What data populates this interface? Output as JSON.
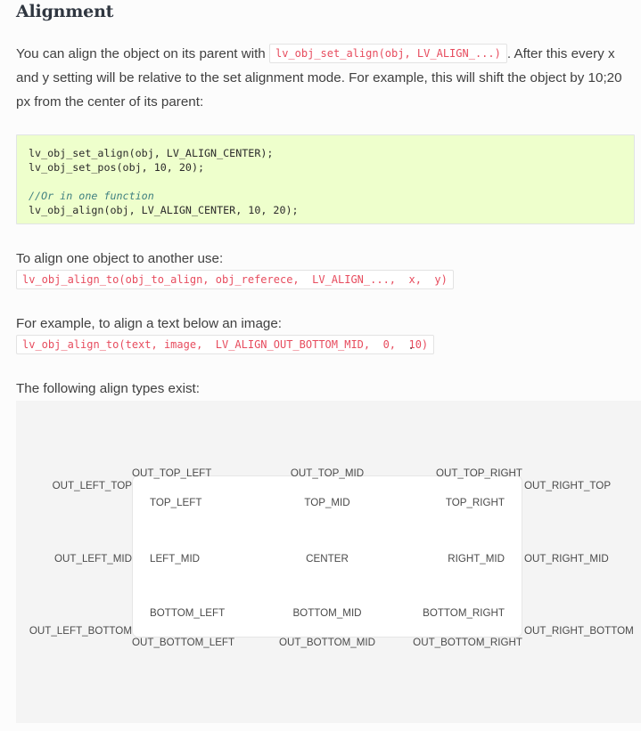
{
  "heading": "Alignment",
  "paragraphs": {
    "intro_part1": "You can align the object on its parent with ",
    "intro_code": "lv_obj_set_align(obj, LV_ALIGN_...)",
    "intro_part2": ". After this every x and y setting will be relative to the set alignment mode. For example, this will shift the object by 10;20 px from the center of its parent:",
    "align_to_label": "To align one object to another use:",
    "align_to_code": "lv_obj_align_to(obj_to_align, obj_referece,  LV_ALIGN_...,  x,  y)",
    "example_label": "For example, to align a text below an image:",
    "example_code": "lv_obj_align_to(text, image,  LV_ALIGN_OUT_BOTTOM_MID,  0,  10)",
    "example_period": ".",
    "types_label": "The following align types exist:"
  },
  "code_block": {
    "line1": "lv_obj_set_align(obj, LV_ALIGN_CENTER);",
    "line2": "lv_obj_set_pos(obj, 10, 20);",
    "line3": "",
    "comment": "//Or in one function",
    "line5": "lv_obj_align(obj, LV_ALIGN_CENTER, 10, 20);"
  },
  "diagram": {
    "inner": {
      "top_left": "TOP_LEFT",
      "top_mid": "TOP_MID",
      "top_right": "TOP_RIGHT",
      "left_mid": "LEFT_MID",
      "center": "CENTER",
      "right_mid": "RIGHT_MID",
      "bottom_left": "BOTTOM_LEFT",
      "bottom_mid": "BOTTOM_MID",
      "bottom_right": "BOTTOM_RIGHT"
    },
    "outer": {
      "out_top_left": "OUT_TOP_LEFT",
      "out_top_mid": "OUT_TOP_MID",
      "out_top_right": "OUT_TOP_RIGHT",
      "out_left_top": "OUT_LEFT_TOP",
      "out_left_mid": "OUT_LEFT_MID",
      "out_left_bottom": "OUT_LEFT_BOTTOM",
      "out_right_top": "OUT_RIGHT_TOP",
      "out_right_mid": "OUT_RIGHT_MID",
      "out_right_bottom": "OUT_RIGHT_BOTTOM",
      "out_bottom_left": "OUT_BOTTOM_LEFT",
      "out_bottom_mid": "OUT_BOTTOM_MID",
      "out_bottom_right": "OUT_BOTTOM_RIGHT"
    }
  },
  "colors": {
    "page_background": "#fcfcfc",
    "code_block_background": "#eeffcc",
    "inline_code_text": "#e74c5e",
    "diagram_background": "#f4f4f4",
    "inner_box_background": "#ffffff",
    "heading_text": "#2f3640",
    "body_text": "#404040"
  }
}
